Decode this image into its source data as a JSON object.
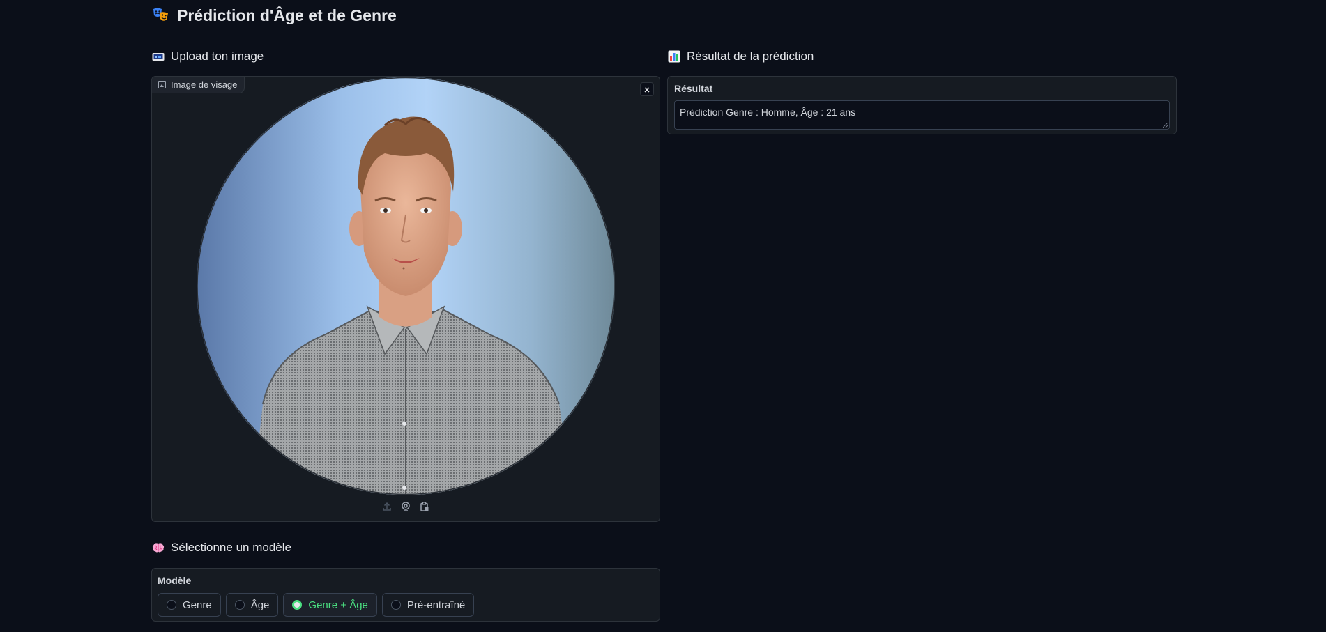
{
  "app": {
    "title": "Prédiction d'Âge et de Genre",
    "title_icon": "performing-arts-masks-icon"
  },
  "upload_section": {
    "title": "Upload ton image",
    "icon": "image-frame-icon",
    "image_label": "Image de visage",
    "clear_icon": "close-icon",
    "source_icons": [
      "upload-icon",
      "webcam-icon",
      "clipboard-icon"
    ]
  },
  "result_section": {
    "title": "Résultat de la prédiction",
    "icon": "bar-chart-icon",
    "field_label": "Résultat",
    "value": "Prédiction Genre : Homme, Âge : 21 ans"
  },
  "model_section": {
    "title": "Sélectionne un modèle",
    "icon": "brain-icon",
    "field_label": "Modèle",
    "options": [
      {
        "label": "Genre",
        "selected": false
      },
      {
        "label": "Âge",
        "selected": false
      },
      {
        "label": "Genre + Âge",
        "selected": true
      },
      {
        "label": "Pré-entraîné",
        "selected": false
      }
    ]
  },
  "colors": {
    "background": "#0b0f19",
    "panel": "#161b22",
    "border": "#2d333b",
    "accent_selected": "#4ade80"
  }
}
